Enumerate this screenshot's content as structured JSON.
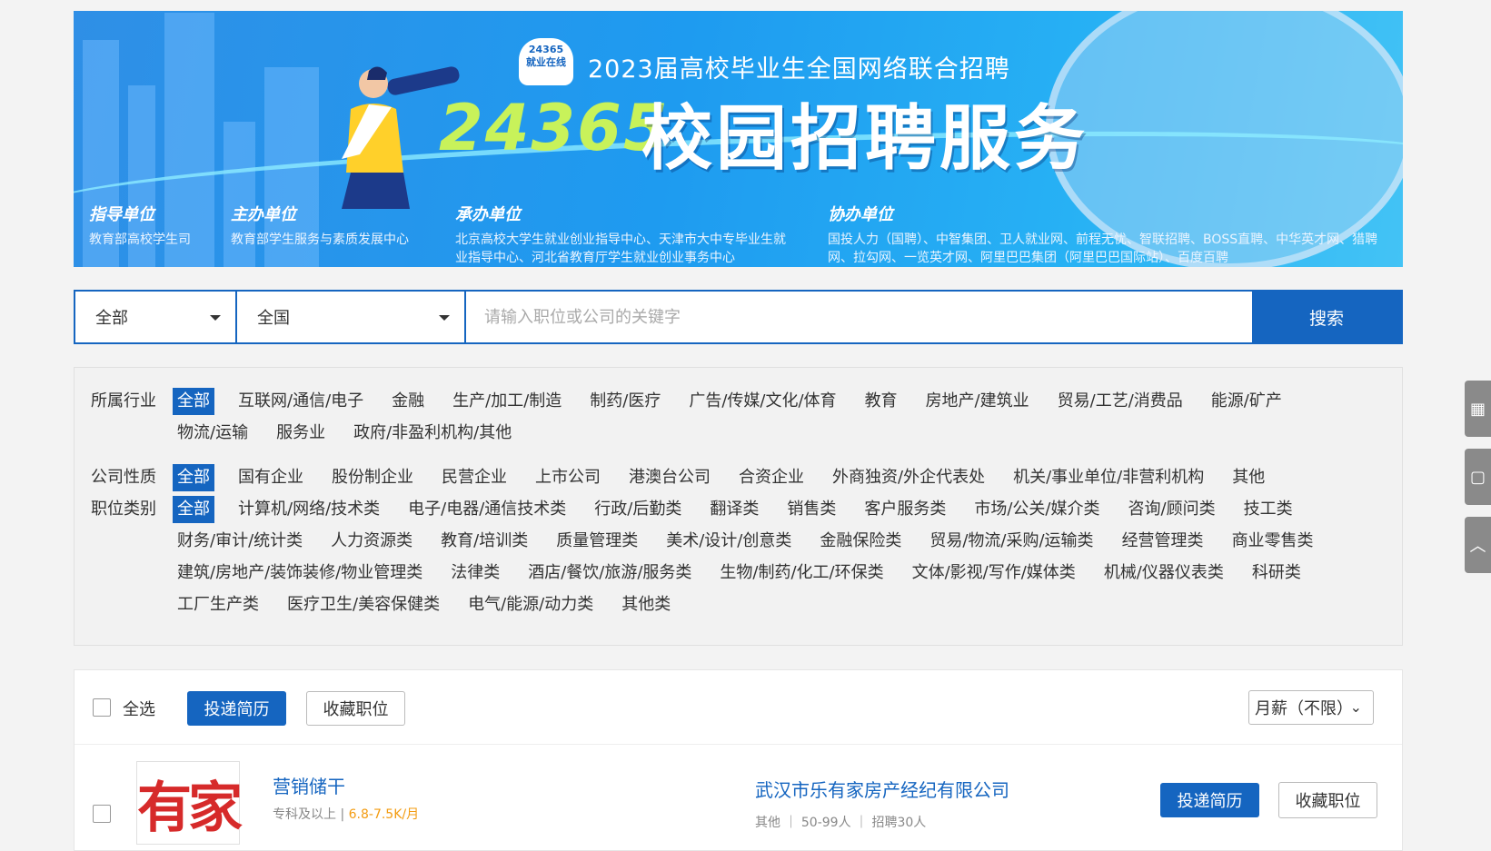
{
  "banner": {
    "logo_text": "24365\n就业在线",
    "subtitle": "2023届高校毕业生全国网络联合招聘",
    "number": "24365",
    "title": "校园招聘服务",
    "orgs": [
      {
        "heading": "指导单位",
        "text": "教育部高校学生司"
      },
      {
        "heading": "主办单位",
        "text": "教育部学生服务与素质发展中心"
      },
      {
        "heading": "承办单位",
        "text": "北京高校大学生就业创业指导中心、天津市大中专毕业生就业指导中心、河北省教育厅学生就业创业事务中心"
      },
      {
        "heading": "协办单位",
        "text": "国投人力（国聘）、中智集团、卫人就业网、前程无忧、智联招聘、BOSS直聘、中华英才网、猎聘网、拉勾网、一览英才网、阿里巴巴集团（阿里巴巴国际站）、百度百聘"
      }
    ]
  },
  "search": {
    "type_value": "全部",
    "region_value": "全国",
    "placeholder": "请输入职位或公司的关键字",
    "button": "搜索"
  },
  "filters": {
    "industry": {
      "label": "所属行业",
      "options": [
        "全部",
        "互联网/通信/电子",
        "金融",
        "生产/加工/制造",
        "制药/医疗",
        "广告/传媒/文化/体育",
        "教育",
        "房地产/建筑业",
        "贸易/工艺/消费品",
        "能源/矿产",
        "物流/运输",
        "服务业",
        "政府/非盈利机构/其他"
      ]
    },
    "nature": {
      "label": "公司性质",
      "options": [
        "全部",
        "国有企业",
        "股份制企业",
        "民营企业",
        "上市公司",
        "港澳台公司",
        "合资企业",
        "外商独资/外企代表处",
        "机关/事业单位/非营利机构",
        "其他"
      ]
    },
    "category": {
      "label": "职位类别",
      "options": [
        "全部",
        "计算机/网络/技术类",
        "电子/电器/通信技术类",
        "行政/后勤类",
        "翻译类",
        "销售类",
        "客户服务类",
        "市场/公关/媒介类",
        "咨询/顾问类",
        "技工类",
        "财务/审计/统计类",
        "人力资源类",
        "教育/培训类",
        "质量管理类",
        "美术/设计/创意类",
        "金融保险类",
        "贸易/物流/采购/运输类",
        "经营管理类",
        "商业零售类",
        "建筑/房地产/装饰装修/物业管理类",
        "法律类",
        "酒店/餐饮/旅游/服务类",
        "生物/制药/化工/环保类",
        "文体/影视/写作/媒体类",
        "机械/仪器仪表类",
        "科研类",
        "工厂生产类",
        "医疗卫生/美容保健类",
        "电气/能源/动力类",
        "其他类"
      ]
    }
  },
  "toolbar": {
    "select_all": "全选",
    "apply": "投递简历",
    "favorite": "收藏职位",
    "salary": "月薪（不限）"
  },
  "job": {
    "logo_text": "有家",
    "title": "营销储干",
    "education": "专科及以上",
    "separator": "|",
    "pay": "6.8-7.5K/月",
    "company": "武汉市乐有家房产经纪有限公司",
    "company_meta": "其他 ｜ 50-99人 ｜ 招聘30人",
    "apply": "投递简历",
    "favorite": "收藏职位"
  },
  "side": {
    "icons": [
      "qrcode-icon",
      "chat-icon",
      "up-icon"
    ]
  }
}
